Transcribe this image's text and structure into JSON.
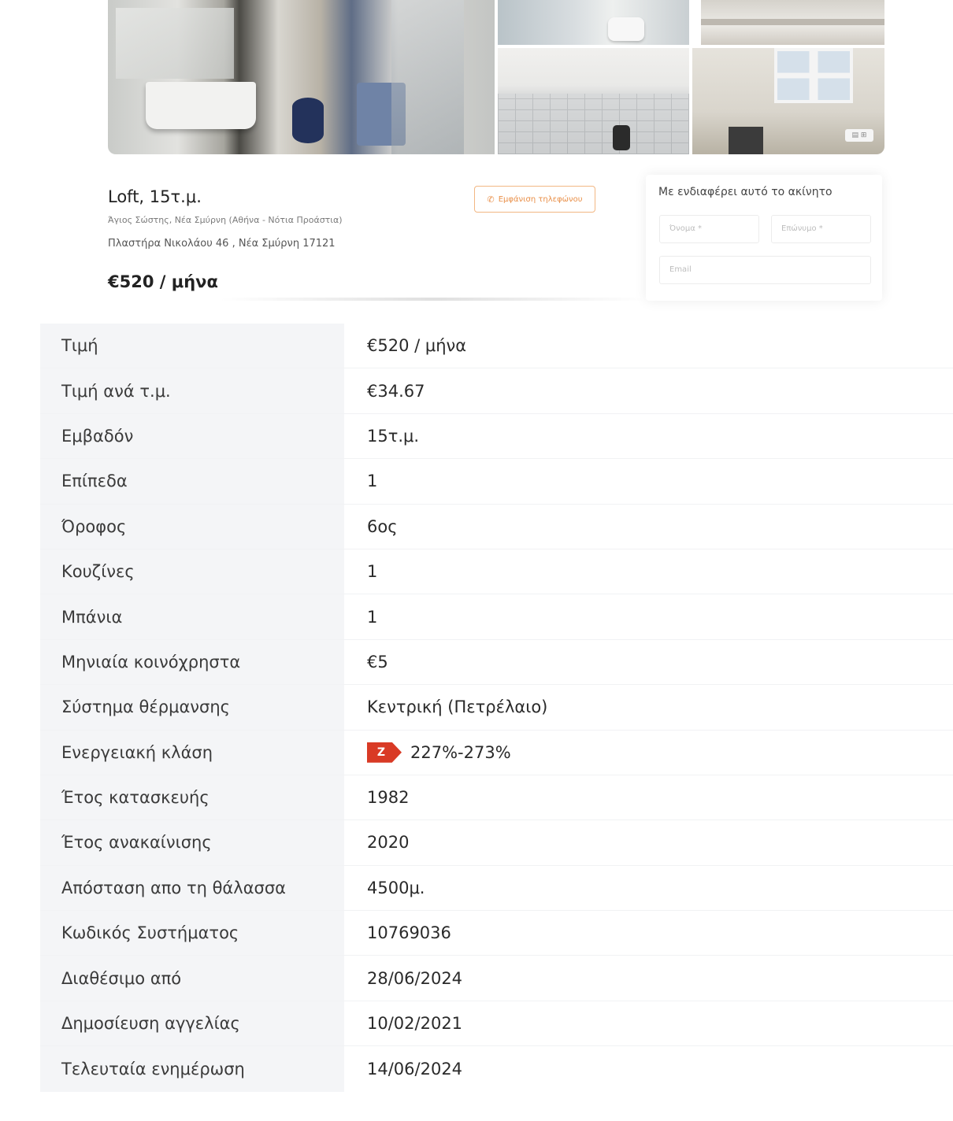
{
  "gallery": {
    "photo_badge": "▤ ⊞"
  },
  "listing": {
    "title": "Loft, 15τ.μ.",
    "location": "Άγιος Σώστης, Νέα Σμύρνη (Αθήνα - Νότια Προάστια)",
    "address": "Πλαστήρα Νικολάου 46 , Νέα Σμύρνη 17121",
    "price": "€520 / μήνα",
    "call_button": "Εμφάνιση τηλεφώνου",
    "phone_icon": "phone-icon"
  },
  "contact": {
    "title": "Με ενδιαφέρει αυτό το ακίνητο",
    "name_placeholder": "Όνομα *",
    "surname_placeholder": "Επώνυμο *",
    "email_placeholder": "Email"
  },
  "details": [
    {
      "label": "Τιμή",
      "value": "€520 / μήνα"
    },
    {
      "label": "Τιμή ανά τ.μ.",
      "value": "€34.67"
    },
    {
      "label": "Εμβαδόν",
      "value": "15τ.μ."
    },
    {
      "label": "Επίπεδα",
      "value": "1"
    },
    {
      "label": "Όροφος",
      "value": "6ος"
    },
    {
      "label": "Κουζίνες",
      "value": "1"
    },
    {
      "label": "Μπάνια",
      "value": "1"
    },
    {
      "label": "Μηνιαία κοινόχρηστα",
      "value": "€5"
    },
    {
      "label": "Σύστημα θέρμανσης",
      "value": "Κεντρική (Πετρέλαιο)"
    },
    {
      "label": "Ενεργειακή κλάση",
      "value": "227%-273%",
      "energy_class": "Z",
      "energy_color": "#d93a25"
    },
    {
      "label": "Έτος κατασκευής",
      "value": "1982"
    },
    {
      "label": "Έτος ανακαίνισης",
      "value": "2020"
    },
    {
      "label": "Απόσταση απο τη θάλασσα",
      "value": "4500μ."
    },
    {
      "label": "Κωδικός Συστήματος",
      "value": "10769036"
    },
    {
      "label": "Διαθέσιμο από",
      "value": "28/06/2024"
    },
    {
      "label": "Δημοσίευση αγγελίας",
      "value": "10/02/2021"
    },
    {
      "label": "Τελευταία ενημέρωση",
      "value": "14/06/2024"
    }
  ]
}
